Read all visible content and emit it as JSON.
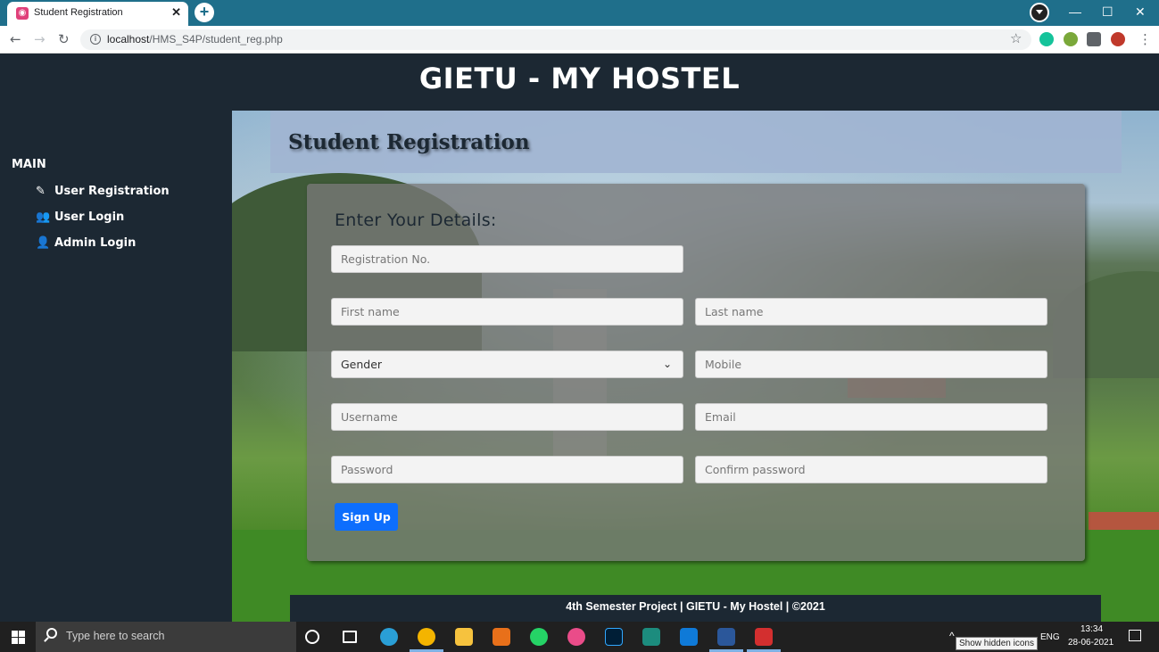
{
  "browser": {
    "tab_title": "Student Registration",
    "url_host": "localhost",
    "url_path": "/HMS_S4P/student_reg.php"
  },
  "site": {
    "title": "GIETU - MY HOSTEL"
  },
  "sidebar": {
    "heading": "MAIN",
    "items": [
      {
        "label": "User Registration",
        "icon": "edit-icon"
      },
      {
        "label": "User Login",
        "icon": "users-icon"
      },
      {
        "label": "Admin Login",
        "icon": "user-cog-icon"
      }
    ]
  },
  "page": {
    "title": "Student Registration"
  },
  "form": {
    "heading": "Enter Your Details:",
    "registration_placeholder": "Registration No.",
    "first_name_placeholder": "First name",
    "last_name_placeholder": "Last name",
    "gender_value": "Gender",
    "mobile_placeholder": "Mobile",
    "username_placeholder": "Username",
    "email_placeholder": "Email",
    "password_placeholder": "Password",
    "confirm_password_placeholder": "Confirm password",
    "submit_label": "Sign Up"
  },
  "footer": {
    "text": "4th Semester Project   |  GIETU - My Hostel   |   ©2021"
  },
  "taskbar": {
    "search_placeholder": "Type here to search",
    "language": "ENG",
    "time": "13:34",
    "date": "28-06-2021",
    "tooltip": "Show hidden icons"
  },
  "colors": {
    "header_bg": "#1c2833",
    "banner_bg": "#a0b4d2",
    "button_bg": "#0d6efd",
    "chrome_tabbar": "#1f6f8b"
  }
}
